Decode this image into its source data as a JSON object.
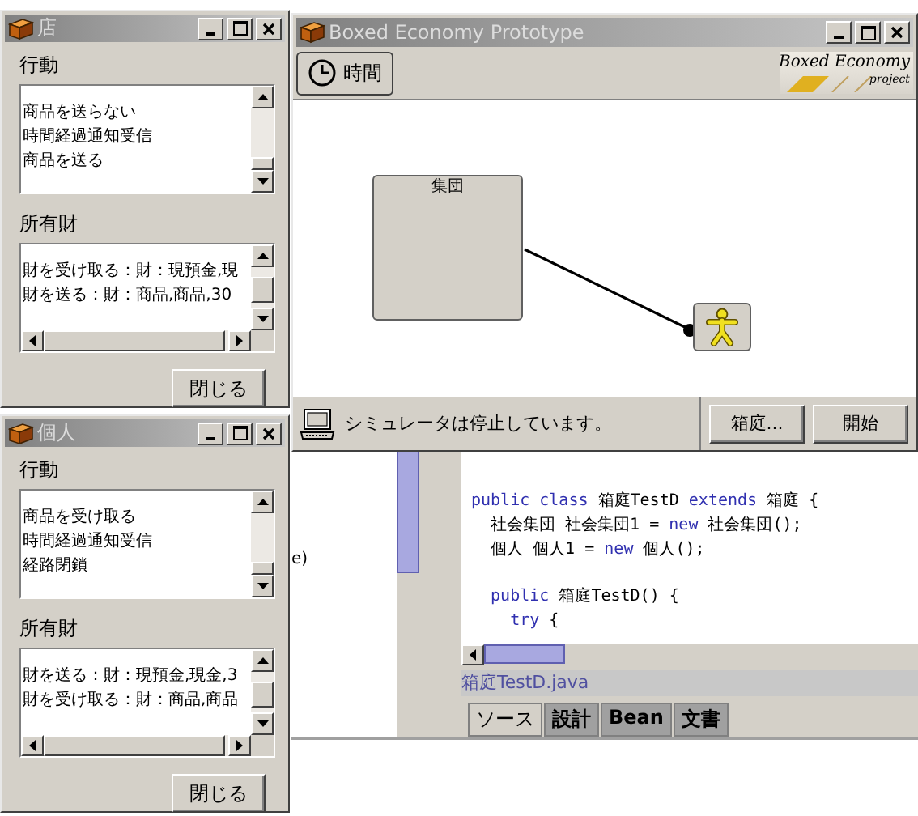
{
  "agent_windows": [
    {
      "title": "店",
      "sections": [
        {
          "label": "行動",
          "items": [
            "商品を送らない",
            "時間経過通知受信",
            "商品を送る"
          ],
          "hscroll": false
        },
        {
          "label": "所有財",
          "items": [
            "財を受け取る：財：現預金,現",
            "財を送る：財：商品,商品,30"
          ],
          "hscroll": true
        }
      ],
      "close_button": "閉じる"
    },
    {
      "title": "個人",
      "sections": [
        {
          "label": "行動",
          "items": [
            "商品を受け取る",
            "時間経過通知受信",
            "経路閉鎖"
          ],
          "hscroll": false
        },
        {
          "label": "所有財",
          "items": [
            "財を送る：財：現預金,現金,3",
            "財を受け取る：財：商品,商品"
          ],
          "hscroll": true
        }
      ],
      "close_button": "閉じる"
    }
  ],
  "main_window": {
    "title": "Boxed Economy Prototype",
    "tool_button": "時間",
    "logo": {
      "name": "Boxed Economy",
      "subtitle": "project"
    },
    "nodes": [
      {
        "kind": "group",
        "label": "集団"
      },
      {
        "kind": "person"
      }
    ],
    "status": "シミュレータは停止しています。",
    "buttons": [
      "箱庭...",
      "開始"
    ]
  },
  "editor": {
    "side_text": "e)",
    "code_lines": [
      {
        "blank_before": false,
        "parts": [
          {
            "kind": "keyword",
            "text": "public class"
          },
          {
            "kind": "plain",
            "text": " 箱庭TestD "
          },
          {
            "kind": "keyword",
            "text": "extends"
          },
          {
            "kind": "plain",
            "text": " 箱庭 {"
          }
        ]
      },
      {
        "blank_before": false,
        "parts": [
          {
            "kind": "plain",
            "text": "  社会集団 社会集団1 = "
          },
          {
            "kind": "keyword",
            "text": "new"
          },
          {
            "kind": "plain",
            "text": " 社会集団();"
          }
        ]
      },
      {
        "blank_before": false,
        "parts": [
          {
            "kind": "plain",
            "text": "  個人 個人1 = "
          },
          {
            "kind": "keyword",
            "text": "new"
          },
          {
            "kind": "plain",
            "text": " 個人();"
          }
        ]
      },
      {
        "blank_before": true,
        "parts": [
          {
            "kind": "keyword",
            "text": "  public"
          },
          {
            "kind": "plain",
            "text": " 箱庭TestD() {"
          }
        ]
      },
      {
        "blank_before": false,
        "parts": [
          {
            "kind": "keyword",
            "text": "    try"
          },
          {
            "kind": "plain",
            "text": " {"
          }
        ]
      }
    ],
    "file_name": "箱庭TestD.java",
    "tabs": [
      {
        "label": "ソース",
        "selected": true
      },
      {
        "label": "設計",
        "selected": false
      },
      {
        "label": "Bean",
        "selected": false
      },
      {
        "label": "文書",
        "selected": false
      }
    ]
  }
}
